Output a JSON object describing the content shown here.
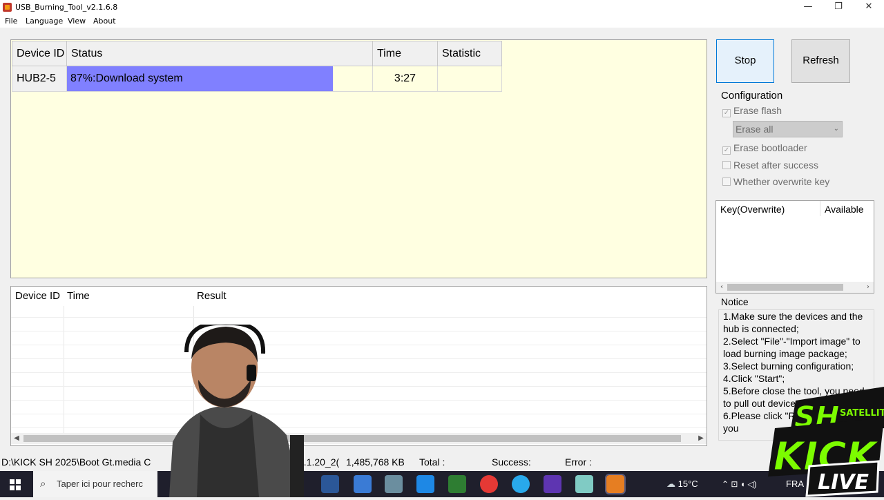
{
  "window": {
    "title": "USB_Burning_Tool_v2.1.6.8",
    "controls": [
      "—",
      "❐",
      "✕"
    ]
  },
  "menu": [
    "File",
    "Language",
    "View",
    "About"
  ],
  "device_table": {
    "headers": [
      "Device ID",
      "Status",
      "Time",
      "Statistic"
    ],
    "row": {
      "device_id": "HUB2-5",
      "status": "87%:Download system",
      "progress": 0.87,
      "time": "3:27",
      "statistic": ""
    },
    "status_color": "#8080ff"
  },
  "log_table": {
    "headers": [
      "Device ID",
      "Time",
      "Result"
    ]
  },
  "buttons": {
    "stop": "Stop",
    "refresh": "Refresh"
  },
  "configuration": {
    "label": "Configuration",
    "erase_flash": "Erase flash",
    "erase_mode": "Erase all",
    "erase_bootloader": "Erase bootloader",
    "reset_after_success": "Reset after success",
    "overwrite_key": "Whether overwrite key"
  },
  "key_panel": {
    "col1": "Key(Overwrite)",
    "col2": "Available"
  },
  "notice": {
    "label": "Notice",
    "lines": [
      "1.Make sure the devices and the hub is connected;",
      "2.Select \"File\"-\"Import image\" to load burning image package;",
      "3.Select burning configuration;",
      "4.Click \"Start\";",
      "5.Before close the tool, you need to pull out devices or click \"Stop\".",
      "6.Please click \"Refresh\" before you"
    ]
  },
  "statusbar": {
    "path": "D:\\KICK SH 2025\\Boot Gt.media C",
    "image_date": "9.1.20_2(",
    "size": "1,485,768 KB",
    "total": "Total :",
    "success": "Success:",
    "error": "Error :"
  },
  "taskbar": {
    "search_placeholder": "Taper ici pour recherc",
    "weather": "15°C",
    "lang": "FRA"
  },
  "overlay_logo": {
    "sh": "SH",
    "satellite": "SATELLITE",
    "kick": "KICK",
    "live": "LIVE"
  }
}
